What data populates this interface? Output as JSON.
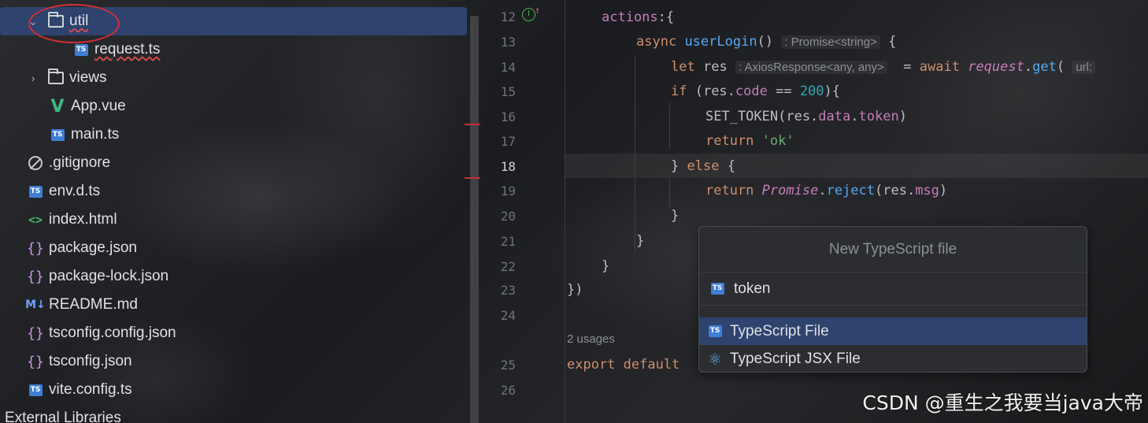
{
  "project_tree": {
    "items": [
      {
        "label": "util",
        "icon": "folder-icon",
        "expanded": true,
        "selected": true
      },
      {
        "label": "request.ts",
        "icon": "ts-icon"
      },
      {
        "label": "views",
        "icon": "folder-icon",
        "expanded": false
      },
      {
        "label": "App.vue",
        "icon": "vue-icon"
      },
      {
        "label": "main.ts",
        "icon": "ts-icon"
      },
      {
        "label": ".gitignore",
        "icon": "ignore-icon"
      },
      {
        "label": "env.d.ts",
        "icon": "ts-icon"
      },
      {
        "label": "index.html",
        "icon": "html-icon"
      },
      {
        "label": "package.json",
        "icon": "json-icon"
      },
      {
        "label": "package-lock.json",
        "icon": "json-icon"
      },
      {
        "label": "README.md",
        "icon": "markdown-icon"
      },
      {
        "label": "tsconfig.config.json",
        "icon": "json-icon"
      },
      {
        "label": "tsconfig.json",
        "icon": "json-icon"
      },
      {
        "label": "vite.config.ts",
        "icon": "ts-icon"
      },
      {
        "label": "External Libraries",
        "icon": ""
      }
    ]
  },
  "editor": {
    "line_numbers": [
      "12",
      "13",
      "14",
      "15",
      "16",
      "17",
      "18",
      "19",
      "20",
      "21",
      "22",
      "23",
      "24",
      "25",
      "26"
    ],
    "current_line": "18",
    "usages_hint": "2 usages",
    "inlay_return_type": ": Promise<string>",
    "inlay_res_type": ": AxiosResponse<any, any>",
    "inlay_param": "url:",
    "code": {
      "l12_actions": "actions",
      "l12_rest": ":{",
      "l13_async": "async",
      "l13_name": "userLogin",
      "l13_parens": "()",
      "l13_brace": "{",
      "l14_let": "let",
      "l14_res": "res",
      "l14_eq": "=",
      "l14_await": "await",
      "l14_request": "request",
      "l14_get": "get",
      "l14_open": "(",
      "l15_if": "if",
      "l15_open": " (res.",
      "l15_code": "code",
      "l15_eq": " == ",
      "l15_num": "200",
      "l15_close": "){",
      "l16_call": "SET_TOKEN(res.",
      "l16_data": "data",
      "l16_dot": ".",
      "l16_token": "token",
      "l16_close": ")",
      "l17_return": "return",
      "l17_str": "'ok'",
      "l18_close": "}",
      "l18_else": "else",
      "l18_brace": "{",
      "l19_return": "return",
      "l19_promise": "Promise",
      "l19_reject": "reject",
      "l19_args_open": "(res.",
      "l19_msg": "msg",
      "l19_args_close": ")",
      "l20": "}",
      "l21": "}",
      "l22": "}",
      "l23": "})",
      "l25_export": "export default"
    }
  },
  "popup": {
    "title": "New TypeScript file",
    "input_value": "token",
    "options": [
      {
        "label": "TypeScript File",
        "icon": "ts-icon",
        "active": true
      },
      {
        "label": "TypeScript JSX File",
        "icon": "react-icon",
        "active": false
      }
    ]
  },
  "watermark": "CSDN @重生之我要当java大帝",
  "colors": {
    "selection": "#2e436e",
    "keyword": "#cf8e6d",
    "function": "#56a8f5",
    "property": "#c77dbb",
    "number": "#2aacb8",
    "string": "#6aab73",
    "annotation_circle": "#d22f35"
  }
}
